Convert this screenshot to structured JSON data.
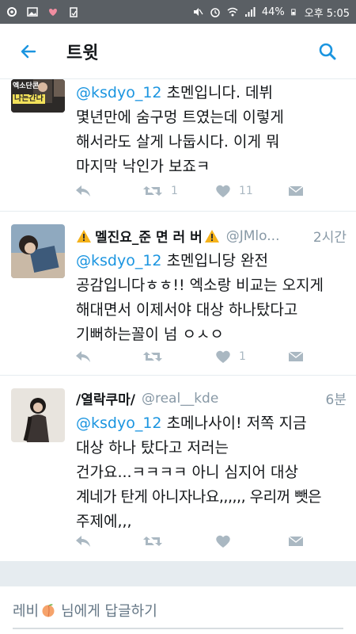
{
  "status_bar": {
    "battery": "44%",
    "time": "오후 5:05"
  },
  "app_bar": {
    "title": "트윗"
  },
  "tweets": [
    {
      "mention": "@ksdyo_12",
      "lines": [
        "초멘입니다. 데뷔",
        "몇년만에 숨구멍 트였는데 이렇게",
        "해서라도 살게 나둡시다. 이게 뭐",
        "마지막 낙인가 보죠ㅋ"
      ],
      "retweets": "1",
      "likes": "11",
      "avatar_text_top": "엑소단콘",
      "avatar_text_bottom": "나는간다"
    },
    {
      "name": "멜진요_준 면 러 버",
      "handle": "@JMlo...",
      "time": "2시간",
      "mention": "@ksdyo_12",
      "lines": [
        "초멘입니당 완전",
        "공감입니다ㅎㅎ!! 엑소랑 비교는 오지게",
        "해대면서 이제서야 대상 하나탔다고",
        "기뻐하는꼴이 넘 ㅇㅅㅇ"
      ],
      "retweets": "",
      "likes": "1"
    },
    {
      "name": "/열락쿠마/",
      "handle": "@real__kde",
      "time": "6분",
      "mention": "@ksdyo_12",
      "lines": [
        "초메나사이! 저쪽 지금",
        "대상 하나 탔다고 저러는",
        "건가요...ㅋㅋㅋㅋ 아니 심지어 대상",
        "계네가 탄게 아니자나요,,,,,, 우리꺼 뺏은",
        "주제에,,,"
      ],
      "retweets": "",
      "likes": ""
    }
  ],
  "reply_bar": {
    "prefix": "레비",
    "suffix": "님에게 답글하기"
  },
  "colors": {
    "accent": "#1b95e0",
    "icon_gray": "#aab8c2",
    "separator": "#e6ecf0"
  }
}
